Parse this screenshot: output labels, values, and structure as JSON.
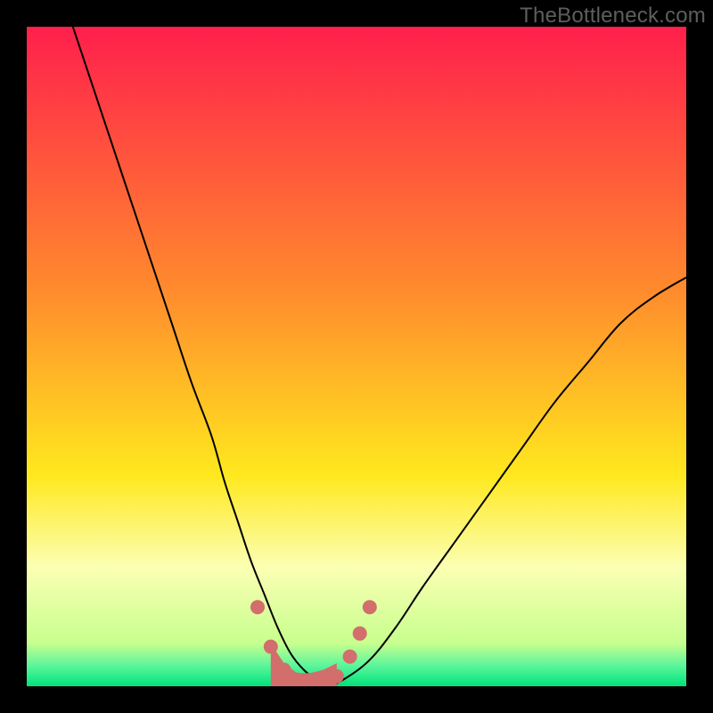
{
  "watermark": "TheBottleneck.com",
  "chart_data": {
    "type": "line",
    "title": "",
    "xlabel": "",
    "ylabel": "",
    "xlim": [
      0,
      100
    ],
    "ylim": [
      0,
      100
    ],
    "grid": false,
    "legend": false,
    "background_gradient": [
      {
        "pos": 0.0,
        "color": "#ff1f4c"
      },
      {
        "pos": 0.4,
        "color": "#ff8b2d"
      },
      {
        "pos": 0.68,
        "color": "#ffe81e"
      },
      {
        "pos": 0.82,
        "color": "#fbffb3"
      },
      {
        "pos": 0.935,
        "color": "#c7ff8e"
      },
      {
        "pos": 0.97,
        "color": "#58f59b"
      },
      {
        "pos": 1.0,
        "color": "#00e37a"
      }
    ],
    "series": [
      {
        "name": "bottleneck-curve",
        "stroke": "#000000",
        "stroke_width": 2,
        "x": [
          7,
          10,
          13,
          16,
          19,
          22,
          25,
          28,
          30,
          32,
          34,
          36,
          38,
          40,
          42,
          44,
          46,
          48,
          52,
          56,
          60,
          65,
          70,
          75,
          80,
          85,
          90,
          95,
          100
        ],
        "y": [
          100,
          91,
          82,
          73,
          64,
          55,
          46,
          38,
          31,
          25,
          19,
          14,
          9,
          5,
          2.5,
          1,
          0.3,
          1,
          4,
          9,
          15,
          22,
          29,
          36,
          43,
          49,
          55,
          59,
          62
        ]
      },
      {
        "name": "highlight-markers",
        "type": "scatter",
        "marker_color": "#d26e6c",
        "marker_radius": 8,
        "x": [
          35,
          37,
          39,
          41,
          43,
          45,
          47,
          49,
          50.5,
          52
        ],
        "y": [
          12,
          6,
          2.5,
          1,
          0.7,
          0.7,
          1.5,
          4.5,
          8,
          12
        ]
      },
      {
        "name": "highlight-blob",
        "type": "area",
        "fill": "#d26e6c",
        "x": [
          37,
          39,
          41,
          43,
          45,
          47
        ],
        "y_top": [
          6.5,
          3.5,
          2,
          2,
          2.5,
          3.5
        ],
        "y_bottom": [
          0,
          0,
          0,
          0,
          0,
          0
        ]
      }
    ]
  }
}
